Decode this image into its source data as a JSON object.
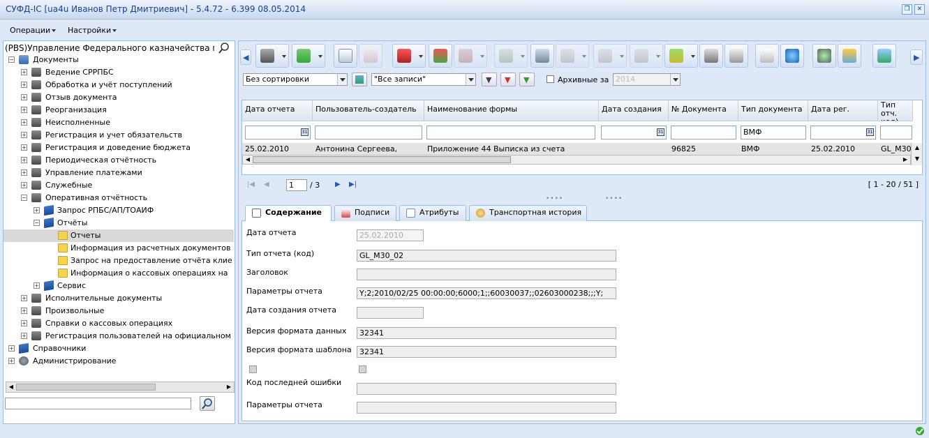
{
  "window": {
    "title": "СУФД-IC [ua4u Иванов Петр Дмитриевич] - 5.4.72 - 6.399 08.05.2014"
  },
  "menu": {
    "operations": "Операции",
    "settings": "Настройки"
  },
  "left_panel": {
    "header": "(PBS)Управление Федерального казначейства по",
    "tree": {
      "documents": "Документы",
      "srrpbs": "Ведение СРРПБС",
      "receipts": "Обработка и учёт поступлений",
      "recall": "Отзыв документа",
      "reorg": "Реорганизация",
      "unexecuted": "Неисполненные",
      "obligations": "Регистрация и учет обязательств",
      "budget": "Регистрация и доведение бюджета",
      "periodic": "Периодическая отчётность",
      "payments": "Управление платежами",
      "service": "Служебные",
      "operational": "Оперативная отчётность",
      "rpbs_request": "Запрос РПБС/АП/ТОАИФ",
      "reports_folder": "Отчёты",
      "reports": "Отчеты",
      "info_settlement": "Информация из расчетных документов",
      "report_request": "Запрос на предоставление отчёта клие",
      "cash_info": "Информация о кассовых операциях на",
      "servis": "Сервис",
      "executive": "Исполнительные документы",
      "arbitrary": "Произвольные",
      "cash_refs": "Справки о кассовых операциях",
      "user_reg": "Регистрация пользователей на официальном",
      "directories": "Справочники",
      "admin": "Администрирование"
    },
    "search_value": ""
  },
  "filters": {
    "sort": "Без сортировки",
    "records": "\"Все записи\"",
    "archive_label": "Архивные за",
    "archive_year": "2014"
  },
  "grid": {
    "columns": [
      "Дата отчета",
      "Пользователь-создатель",
      "Наименование формы",
      "Дата создания",
      "№ Документа",
      "Тип документа",
      "Дата рег.",
      "Тип отч. код)"
    ],
    "filter_doc_type": "ВМФ",
    "row": [
      "25.02.2010",
      "Антонина Сергеева,",
      "Приложение 44 Выписка из счета",
      "",
      "96825",
      "ВМФ",
      "25.02.2010",
      "GL_M30"
    ]
  },
  "pager": {
    "page": "1",
    "of": "/ 3",
    "range": "[ 1 - 20 / 51 ]"
  },
  "tabs": {
    "content": "Содержание",
    "signatures": "Подписи",
    "attributes": "Атрибуты",
    "transport": "Транспортная история"
  },
  "form": {
    "report_date_label": "Дата отчета",
    "report_date": "25.02.2010",
    "report_type_label": "Тип отчета (код)",
    "report_type": "GL_M30_02",
    "header_label": "Заголовок",
    "header": "",
    "params_label": "Параметры отчета",
    "params": "Y;2;2010/02/25 00:00:00;6000;1;;60030037;;02603000238;;;Y;",
    "created_label": "Дата создания отчета",
    "created": "",
    "data_format_label": "Версия формата данных",
    "data_format": "32341",
    "template_format_label": "Версия формата шаблона",
    "template_format": "32341",
    "last_error_label": "Код последней ошибки",
    "last_error": "",
    "params2_label": "Параметры отчета",
    "params2": ""
  },
  "colors": {
    "accent": "#99bbe8",
    "title": "#15428b",
    "selected": "#d9d9d9"
  }
}
